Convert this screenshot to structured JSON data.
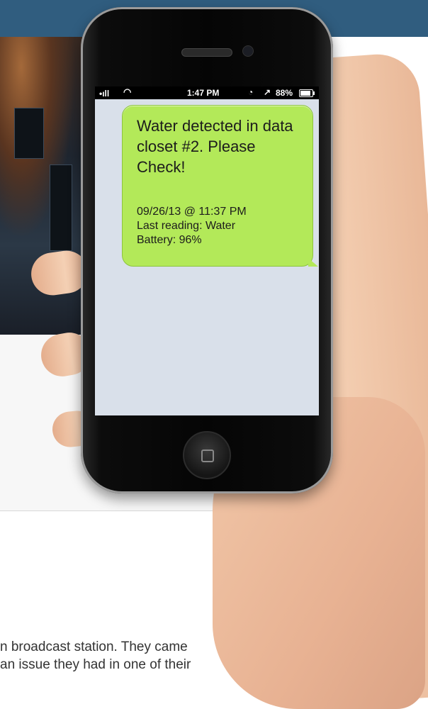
{
  "phone": {
    "status_bar": {
      "signal": "•ıll",
      "wifi": "◠",
      "time": "1:47 PM",
      "lock": "◔",
      "location": "↗",
      "battery_percent": "88%"
    },
    "message": {
      "text": "Water detected in data closet #2. Please Check!",
      "timestamp": "09/26/13 @ 11:37 PM",
      "last_reading": "Last reading: Water",
      "battery": "Battery: 96%"
    }
  },
  "article": {
    "line1": "n broadcast station. They came",
    "line2": "an issue they had in one of their"
  },
  "colors": {
    "banner": "#305d7f",
    "bubble": "#b3e959",
    "screen": "#d9e0ea"
  }
}
